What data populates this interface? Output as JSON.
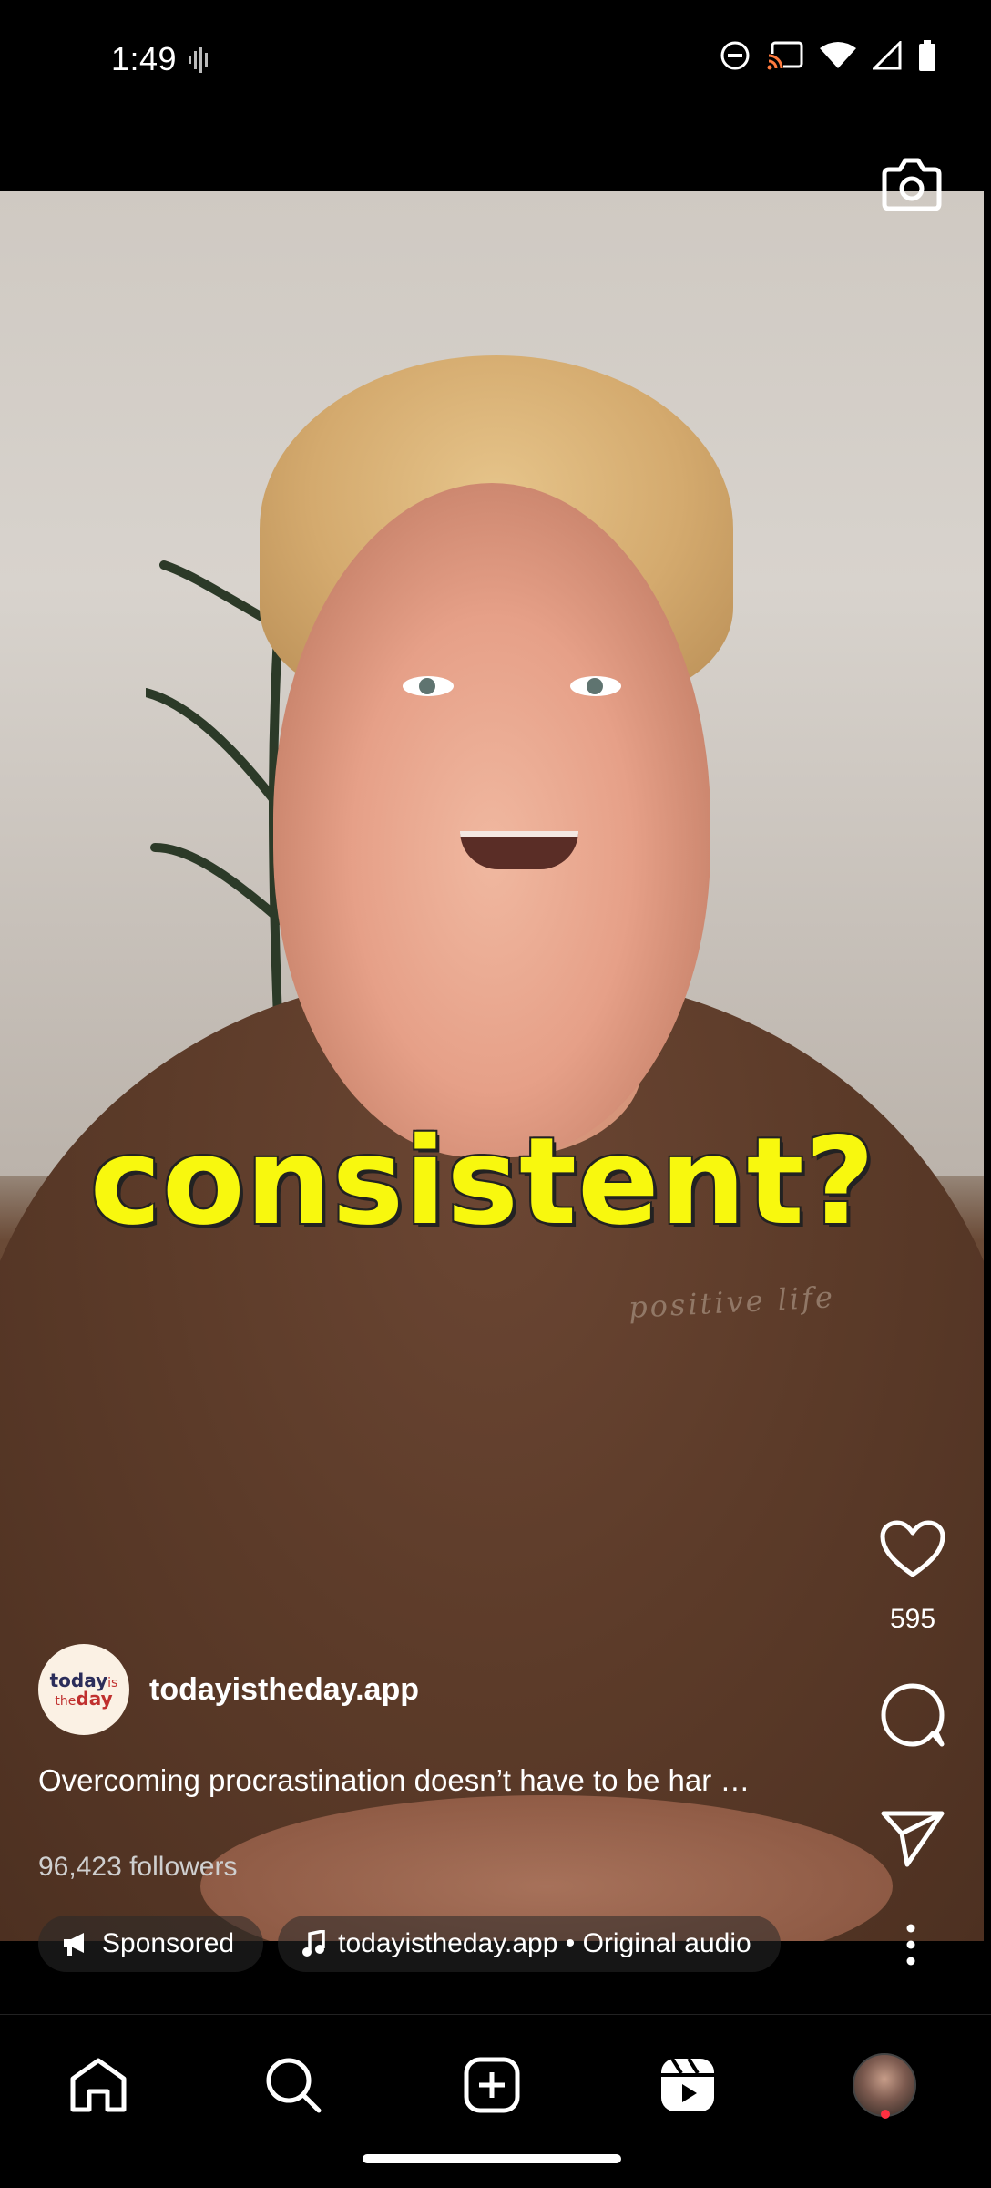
{
  "status_bar": {
    "time": "1:49",
    "icons": [
      "voice-recorder-icon",
      "do-not-disturb-icon",
      "cast-icon",
      "wifi-icon",
      "signal-icon",
      "battery-icon"
    ]
  },
  "video": {
    "caption_overlay": "consistent?",
    "shirt_print": "positive life"
  },
  "actions": {
    "like_count": "595",
    "icons": [
      "camera-icon",
      "heart-icon",
      "comment-icon",
      "send-icon",
      "more-icon"
    ]
  },
  "post": {
    "account_name": "todayistheday.app",
    "logo": {
      "line1_bold": "today",
      "line1_small": "is",
      "line2_small": "the",
      "line2_bold": "day"
    },
    "description": "Overcoming procrastination doesn’t have to be har …",
    "followers": "96,423 followers",
    "chips": [
      {
        "label": "Sponsored",
        "icon": "megaphone-icon"
      },
      {
        "label": "todayistheday.app • Original audio",
        "icon": "music-note-icon"
      }
    ]
  },
  "bottom_nav": {
    "items": [
      "home-icon",
      "search-icon",
      "create-icon",
      "reels-icon",
      "profile-avatar"
    ],
    "colors": {
      "notification_dot": "#ff3040",
      "caption_yellow": "#f8f80e"
    }
  }
}
